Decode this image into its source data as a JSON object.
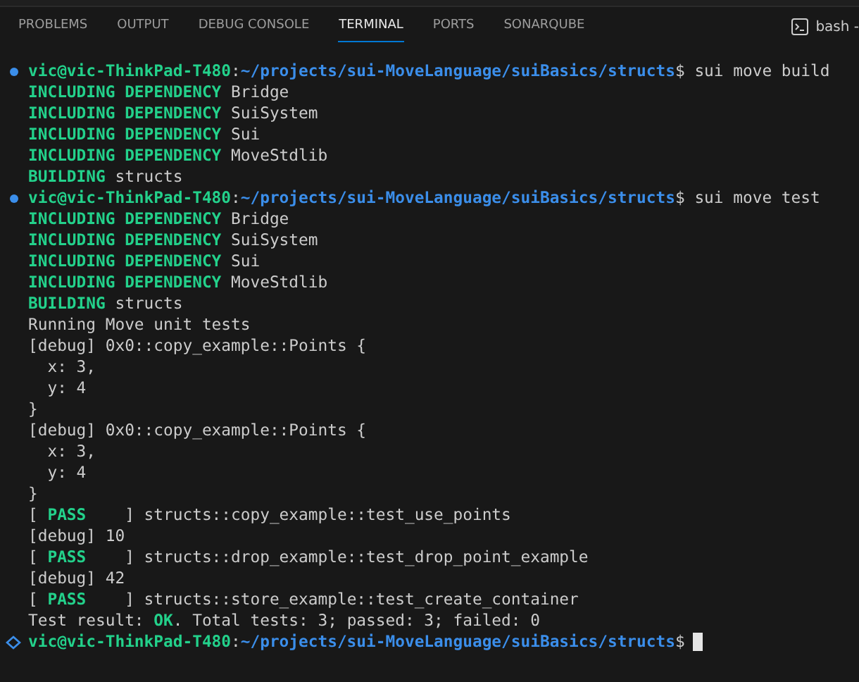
{
  "tabs": [
    {
      "label": "PROBLEMS",
      "selected": false
    },
    {
      "label": "OUTPUT",
      "selected": false
    },
    {
      "label": "DEBUG CONSOLE",
      "selected": false
    },
    {
      "label": "TERMINAL",
      "selected": true
    },
    {
      "label": "PORTS",
      "selected": false
    },
    {
      "label": "SONARQUBE",
      "selected": false
    }
  ],
  "terminal_switcher": {
    "label": "bash -"
  },
  "lines": [
    {
      "kind": "prompt",
      "completed": true,
      "user": "vic@vic-ThinkPad-T480",
      "separator": ":",
      "path": "~/projects/sui-MoveLanguage/suiBasics/structs",
      "sign": "$",
      "command": "sui move build"
    },
    {
      "kind": "status",
      "tag": "INCLUDING DEPENDENCY",
      "text": "Bridge"
    },
    {
      "kind": "status",
      "tag": "INCLUDING DEPENDENCY",
      "text": "SuiSystem"
    },
    {
      "kind": "status",
      "tag": "INCLUDING DEPENDENCY",
      "text": "Sui"
    },
    {
      "kind": "status",
      "tag": "INCLUDING DEPENDENCY",
      "text": "MoveStdlib"
    },
    {
      "kind": "status",
      "tag": "BUILDING",
      "text": "structs"
    },
    {
      "kind": "prompt",
      "completed": true,
      "user": "vic@vic-ThinkPad-T480",
      "separator": ":",
      "path": "~/projects/sui-MoveLanguage/suiBasics/structs",
      "sign": "$",
      "command": "sui move test"
    },
    {
      "kind": "status",
      "tag": "INCLUDING DEPENDENCY",
      "text": "Bridge"
    },
    {
      "kind": "status",
      "tag": "INCLUDING DEPENDENCY",
      "text": "SuiSystem"
    },
    {
      "kind": "status",
      "tag": "INCLUDING DEPENDENCY",
      "text": "Sui"
    },
    {
      "kind": "status",
      "tag": "INCLUDING DEPENDENCY",
      "text": "MoveStdlib"
    },
    {
      "kind": "status",
      "tag": "BUILDING",
      "text": "structs"
    },
    {
      "kind": "plain",
      "text": "Running Move unit tests"
    },
    {
      "kind": "plain",
      "text": "[debug] 0x0::copy_example::Points {"
    },
    {
      "kind": "plain",
      "text": "  x: 3,"
    },
    {
      "kind": "plain",
      "text": "  y: 4"
    },
    {
      "kind": "plain",
      "text": "}"
    },
    {
      "kind": "plain",
      "text": "[debug] 0x0::copy_example::Points {"
    },
    {
      "kind": "plain",
      "text": "  x: 3,"
    },
    {
      "kind": "plain",
      "text": "  y: 4"
    },
    {
      "kind": "plain",
      "text": "}"
    },
    {
      "kind": "result",
      "before": "[ ",
      "tag": "PASS",
      "after": "    ] structs::copy_example::test_use_points"
    },
    {
      "kind": "plain",
      "text": "[debug] 10"
    },
    {
      "kind": "result",
      "before": "[ ",
      "tag": "PASS",
      "after": "    ] structs::drop_example::test_drop_point_example"
    },
    {
      "kind": "plain",
      "text": "[debug] 42"
    },
    {
      "kind": "result",
      "before": "[ ",
      "tag": "PASS",
      "after": "    ] structs::store_example::test_create_container"
    },
    {
      "kind": "result",
      "before": "Test result: ",
      "tag": "OK",
      "after": ". Total tests: 3; passed: 3; failed: 0"
    },
    {
      "kind": "prompt",
      "completed": false,
      "user": "vic@vic-ThinkPad-T480",
      "separator": ":",
      "path": "~/projects/sui-MoveLanguage/suiBasics/structs",
      "sign": "$",
      "cursor": true
    }
  ]
}
